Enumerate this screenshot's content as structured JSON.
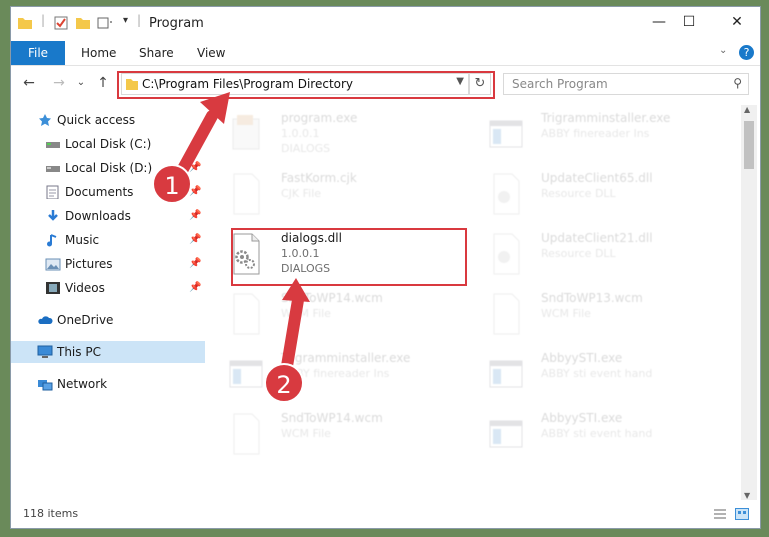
{
  "window": {
    "title": "Program"
  },
  "titlebar": {
    "minimize": "—",
    "maximize": "☐",
    "close": "✕"
  },
  "ribbon": {
    "file": "File",
    "tabs": [
      "Home",
      "Share",
      "View"
    ],
    "help": "?"
  },
  "nav": {
    "back": "←",
    "forward": "→",
    "recent": "⌄",
    "up": "↑"
  },
  "address": {
    "path": "C:\\Program Files\\Program Directory",
    "refresh": "↻"
  },
  "search": {
    "placeholder": "Search Program"
  },
  "sidebar": {
    "items": [
      {
        "label": "Quick access",
        "icon": "star-icon",
        "pinned": false
      },
      {
        "label": "Local Disk (C:)",
        "icon": "drive-icon",
        "pinned": true
      },
      {
        "label": "Local Disk (D:)",
        "icon": "drive-icon",
        "pinned": true
      },
      {
        "label": "Documents",
        "icon": "documents-icon",
        "pinned": true
      },
      {
        "label": "Downloads",
        "icon": "downloads-icon",
        "pinned": true
      },
      {
        "label": "Music",
        "icon": "music-icon",
        "pinned": true
      },
      {
        "label": "Pictures",
        "icon": "pictures-icon",
        "pinned": true
      },
      {
        "label": "Videos",
        "icon": "videos-icon",
        "pinned": true
      },
      {
        "label": "OneDrive",
        "icon": "cloud-icon",
        "pinned": false
      },
      {
        "label": "This PC",
        "icon": "computer-icon",
        "pinned": false,
        "selected": true
      },
      {
        "label": "Network",
        "icon": "network-icon",
        "pinned": false
      }
    ]
  },
  "files": [
    {
      "name": "program.exe",
      "line2": "1.0.0.1",
      "line3": "DIALOGS",
      "icon": "installer-icon",
      "faded": true
    },
    {
      "name": "Trigramminstaller.exe",
      "line2": "ABBY finereader Ins",
      "line3": "",
      "icon": "window-app-icon",
      "faded": true
    },
    {
      "name": "FastKorm.cjk",
      "line2": "CJK File",
      "line3": "",
      "icon": "blank-file-icon",
      "faded": true
    },
    {
      "name": "UpdateClient65.dll",
      "line2": "Resource DLL",
      "line3": "",
      "icon": "gear-file-icon",
      "faded": true
    },
    {
      "name": "dialogs.dll",
      "line2": "1.0.0.1",
      "line3": "DIALOGS",
      "icon": "gear-file-icon",
      "faded": false
    },
    {
      "name": "UpdateClient21.dll",
      "line2": "Resource DLL",
      "line3": "",
      "icon": "gear-file-icon",
      "faded": true
    },
    {
      "name": "SndToWP14.wcm",
      "line2": "WCM File",
      "line3": "",
      "icon": "blank-file-icon",
      "faded": true
    },
    {
      "name": "SndToWP13.wcm",
      "line2": "WCM File",
      "line3": "",
      "icon": "blank-file-icon",
      "faded": true
    },
    {
      "name": "Trigramminstaller.exe",
      "line2": "ABBY finereader Ins",
      "line3": "",
      "icon": "window-app-icon",
      "faded": true
    },
    {
      "name": "AbbyySTI.exe",
      "line2": "ABBY sti event hand",
      "line3": "",
      "icon": "window-app-icon",
      "faded": true
    },
    {
      "name": "SndToWP14.wcm",
      "line2": "WCM File",
      "line3": "",
      "icon": "blank-file-icon",
      "faded": true
    },
    {
      "name": "AbbyySTI.exe",
      "line2": "ABBY sti event hand",
      "line3": "",
      "icon": "window-app-icon",
      "faded": true
    }
  ],
  "status": {
    "count": "118 items"
  },
  "markers": [
    "1",
    "2"
  ],
  "colors": {
    "accent": "#1979ca",
    "highlight": "#d9393f",
    "selected": "#cce4f7"
  }
}
